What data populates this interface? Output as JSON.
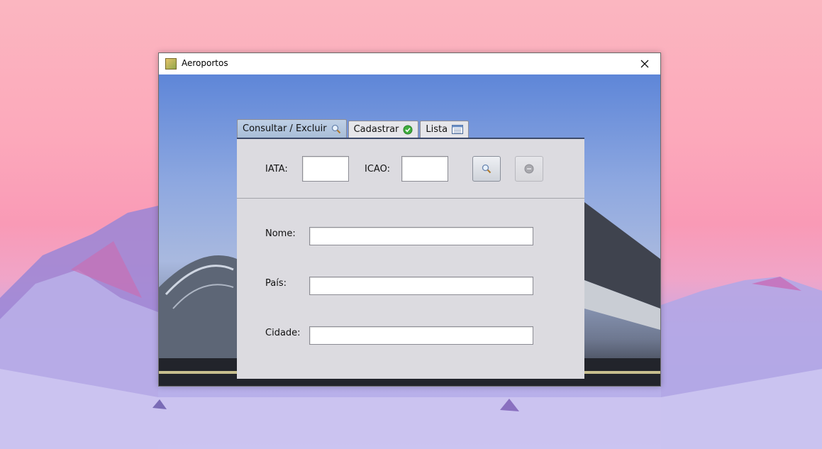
{
  "window": {
    "title": "Aeroportos"
  },
  "tabs": [
    {
      "label": "Consultar / Excluir",
      "icon": "magnifier-icon",
      "active": true
    },
    {
      "label": "Cadastrar",
      "icon": "check-circle-icon",
      "active": false
    },
    {
      "label": "Lista",
      "icon": "list-window-icon",
      "active": false
    }
  ],
  "search": {
    "iata_label": "IATA:",
    "iata_value": "",
    "icao_label": "ICAO:",
    "icao_value": "",
    "search_button_icon": "magnifier-icon",
    "delete_button_icon": "minus-circle-icon"
  },
  "details": {
    "nome_label": "Nome:",
    "nome_value": "",
    "pais_label": "País:",
    "pais_value": "",
    "cidade_label": "Cidade:",
    "cidade_value": ""
  },
  "colors": {
    "active_tab": "#b5c7de",
    "panel_bg": "#dcdbe0",
    "check_green": "#3fae3f"
  }
}
